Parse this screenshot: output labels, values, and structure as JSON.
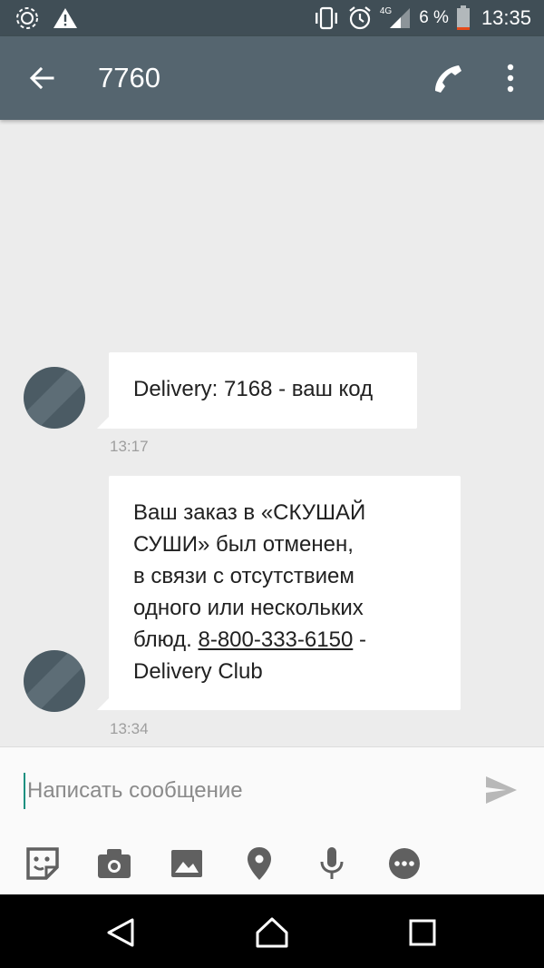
{
  "status_bar": {
    "time": "13:35",
    "battery_percent": "6 %",
    "network_type": "4G",
    "icons": [
      "app-notification-icon",
      "warning-icon",
      "vibrate-icon",
      "alarm-icon",
      "signal-icon",
      "battery-icon"
    ]
  },
  "app_bar": {
    "title": "7760",
    "icons": [
      "back-arrow-icon",
      "phone-icon",
      "more-vert-icon"
    ]
  },
  "messages": [
    {
      "text": "Delivery: 7168 - ваш код",
      "time": "13:17"
    },
    {
      "line1": "Ваш заказ в «СКУШАЙ",
      "line2": "СУШИ» был отменен,",
      "line3": "в связи с отсутствием",
      "line4": "одного или нескольких",
      "line5_prefix": "блюд. ",
      "line5_link": "8-800-333-6150",
      "line5_suffix": " -",
      "line6": "Delivery Club",
      "time": "13:34"
    }
  ],
  "composer": {
    "placeholder": "Написать сообщение",
    "value": "",
    "tool_icons": [
      "sticker-icon",
      "camera-icon",
      "image-icon",
      "location-icon",
      "mic-icon",
      "more-options-icon"
    ]
  },
  "colors": {
    "app_bar": "#55656f",
    "status_bar": "#404e56",
    "background": "#ececec",
    "bubble": "#ffffff",
    "avatar": "#4b5b64",
    "cursor": "#1a9080"
  }
}
